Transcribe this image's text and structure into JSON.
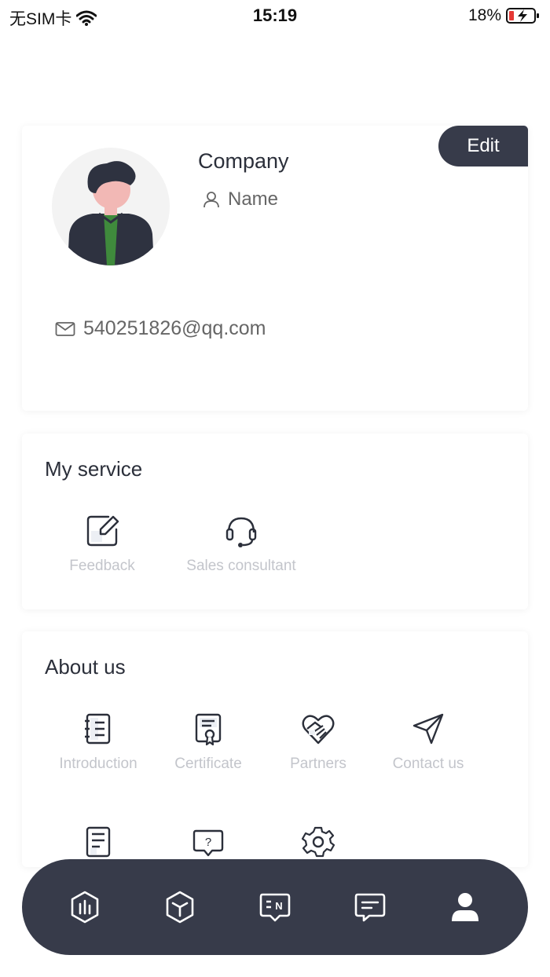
{
  "status_bar": {
    "carrier": "无SIM卡",
    "time": "15:19",
    "battery": "18%"
  },
  "profile": {
    "edit_label": "Edit",
    "company": "Company",
    "name": "Name",
    "email": "540251826@qq.com"
  },
  "service": {
    "title": "My service",
    "items": [
      {
        "label": "Feedback",
        "icon": "feedback-icon"
      },
      {
        "label": "Sales consultant",
        "icon": "headset-icon"
      }
    ]
  },
  "about": {
    "title": "About us",
    "items": [
      {
        "label": "Introduction",
        "icon": "notebook-icon"
      },
      {
        "label": "Certificate",
        "icon": "certificate-icon"
      },
      {
        "label": "Partners",
        "icon": "handshake-heart-icon"
      },
      {
        "label": "Contact us",
        "icon": "send-icon"
      },
      {
        "label": "",
        "icon": "document-icon"
      },
      {
        "label": "",
        "icon": "help-bubble-icon"
      },
      {
        "label": "",
        "icon": "settings-icon"
      }
    ]
  },
  "nav": [
    {
      "icon": "dashboard-shield-icon"
    },
    {
      "icon": "cube-icon"
    },
    {
      "icon": "news-icon"
    },
    {
      "icon": "message-icon"
    },
    {
      "icon": "profile-icon",
      "active": true
    }
  ],
  "colors": {
    "dark": "#373b4a",
    "label_gray": "#c3c5cb",
    "text": "#2b2f3a",
    "avatar_green": "#3f8a3c",
    "skin": "#f2b8b5"
  }
}
